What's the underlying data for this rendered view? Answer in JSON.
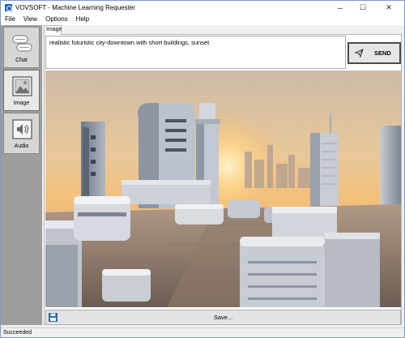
{
  "window": {
    "title": "VOVSOFT - Machine Learning Requester",
    "controls": {
      "minimize": "─",
      "maximize": "☐",
      "close": "✕"
    }
  },
  "menu": {
    "items": [
      {
        "label": "File"
      },
      {
        "label": "View"
      },
      {
        "label": "Options"
      },
      {
        "label": "Help"
      }
    ]
  },
  "sidebar": {
    "items": [
      {
        "label": "Chat",
        "icon": "chat-bubbles-icon",
        "active": false
      },
      {
        "label": "Image",
        "icon": "picture-icon",
        "active": true
      },
      {
        "label": "Audio",
        "icon": "speaker-icon",
        "active": false
      }
    ]
  },
  "tabs": [
    {
      "label": "Image"
    }
  ],
  "prompt": {
    "value": "realistic futuristic city-downtown with short buildings, sunset"
  },
  "send_button": {
    "label": "SEND",
    "icon": "paper-plane-icon"
  },
  "generated_image": {
    "description_icon": "generated-image"
  },
  "save_bar": {
    "label": "Save...",
    "icon": "floppy-disk-icon"
  },
  "status": {
    "text": "Succeeded"
  },
  "colors": {
    "accent": "#1f5fbf",
    "sidebar_bg": "#9e9e9e",
    "sky_top": "#d9c8b0",
    "sun": "#ffd68a"
  }
}
